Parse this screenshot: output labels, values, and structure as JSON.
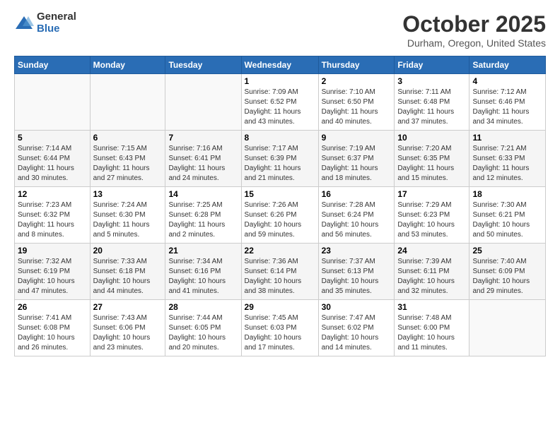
{
  "logo": {
    "general": "General",
    "blue": "Blue"
  },
  "header": {
    "month": "October 2025",
    "location": "Durham, Oregon, United States"
  },
  "weekdays": [
    "Sunday",
    "Monday",
    "Tuesday",
    "Wednesday",
    "Thursday",
    "Friday",
    "Saturday"
  ],
  "weeks": [
    [
      {
        "day": "",
        "info": ""
      },
      {
        "day": "",
        "info": ""
      },
      {
        "day": "",
        "info": ""
      },
      {
        "day": "1",
        "info": "Sunrise: 7:09 AM\nSunset: 6:52 PM\nDaylight: 11 hours\nand 43 minutes."
      },
      {
        "day": "2",
        "info": "Sunrise: 7:10 AM\nSunset: 6:50 PM\nDaylight: 11 hours\nand 40 minutes."
      },
      {
        "day": "3",
        "info": "Sunrise: 7:11 AM\nSunset: 6:48 PM\nDaylight: 11 hours\nand 37 minutes."
      },
      {
        "day": "4",
        "info": "Sunrise: 7:12 AM\nSunset: 6:46 PM\nDaylight: 11 hours\nand 34 minutes."
      }
    ],
    [
      {
        "day": "5",
        "info": "Sunrise: 7:14 AM\nSunset: 6:44 PM\nDaylight: 11 hours\nand 30 minutes."
      },
      {
        "day": "6",
        "info": "Sunrise: 7:15 AM\nSunset: 6:43 PM\nDaylight: 11 hours\nand 27 minutes."
      },
      {
        "day": "7",
        "info": "Sunrise: 7:16 AM\nSunset: 6:41 PM\nDaylight: 11 hours\nand 24 minutes."
      },
      {
        "day": "8",
        "info": "Sunrise: 7:17 AM\nSunset: 6:39 PM\nDaylight: 11 hours\nand 21 minutes."
      },
      {
        "day": "9",
        "info": "Sunrise: 7:19 AM\nSunset: 6:37 PM\nDaylight: 11 hours\nand 18 minutes."
      },
      {
        "day": "10",
        "info": "Sunrise: 7:20 AM\nSunset: 6:35 PM\nDaylight: 11 hours\nand 15 minutes."
      },
      {
        "day": "11",
        "info": "Sunrise: 7:21 AM\nSunset: 6:33 PM\nDaylight: 11 hours\nand 12 minutes."
      }
    ],
    [
      {
        "day": "12",
        "info": "Sunrise: 7:23 AM\nSunset: 6:32 PM\nDaylight: 11 hours\nand 8 minutes."
      },
      {
        "day": "13",
        "info": "Sunrise: 7:24 AM\nSunset: 6:30 PM\nDaylight: 11 hours\nand 5 minutes."
      },
      {
        "day": "14",
        "info": "Sunrise: 7:25 AM\nSunset: 6:28 PM\nDaylight: 11 hours\nand 2 minutes."
      },
      {
        "day": "15",
        "info": "Sunrise: 7:26 AM\nSunset: 6:26 PM\nDaylight: 10 hours\nand 59 minutes."
      },
      {
        "day": "16",
        "info": "Sunrise: 7:28 AM\nSunset: 6:24 PM\nDaylight: 10 hours\nand 56 minutes."
      },
      {
        "day": "17",
        "info": "Sunrise: 7:29 AM\nSunset: 6:23 PM\nDaylight: 10 hours\nand 53 minutes."
      },
      {
        "day": "18",
        "info": "Sunrise: 7:30 AM\nSunset: 6:21 PM\nDaylight: 10 hours\nand 50 minutes."
      }
    ],
    [
      {
        "day": "19",
        "info": "Sunrise: 7:32 AM\nSunset: 6:19 PM\nDaylight: 10 hours\nand 47 minutes."
      },
      {
        "day": "20",
        "info": "Sunrise: 7:33 AM\nSunset: 6:18 PM\nDaylight: 10 hours\nand 44 minutes."
      },
      {
        "day": "21",
        "info": "Sunrise: 7:34 AM\nSunset: 6:16 PM\nDaylight: 10 hours\nand 41 minutes."
      },
      {
        "day": "22",
        "info": "Sunrise: 7:36 AM\nSunset: 6:14 PM\nDaylight: 10 hours\nand 38 minutes."
      },
      {
        "day": "23",
        "info": "Sunrise: 7:37 AM\nSunset: 6:13 PM\nDaylight: 10 hours\nand 35 minutes."
      },
      {
        "day": "24",
        "info": "Sunrise: 7:39 AM\nSunset: 6:11 PM\nDaylight: 10 hours\nand 32 minutes."
      },
      {
        "day": "25",
        "info": "Sunrise: 7:40 AM\nSunset: 6:09 PM\nDaylight: 10 hours\nand 29 minutes."
      }
    ],
    [
      {
        "day": "26",
        "info": "Sunrise: 7:41 AM\nSunset: 6:08 PM\nDaylight: 10 hours\nand 26 minutes."
      },
      {
        "day": "27",
        "info": "Sunrise: 7:43 AM\nSunset: 6:06 PM\nDaylight: 10 hours\nand 23 minutes."
      },
      {
        "day": "28",
        "info": "Sunrise: 7:44 AM\nSunset: 6:05 PM\nDaylight: 10 hours\nand 20 minutes."
      },
      {
        "day": "29",
        "info": "Sunrise: 7:45 AM\nSunset: 6:03 PM\nDaylight: 10 hours\nand 17 minutes."
      },
      {
        "day": "30",
        "info": "Sunrise: 7:47 AM\nSunset: 6:02 PM\nDaylight: 10 hours\nand 14 minutes."
      },
      {
        "day": "31",
        "info": "Sunrise: 7:48 AM\nSunset: 6:00 PM\nDaylight: 10 hours\nand 11 minutes."
      },
      {
        "day": "",
        "info": ""
      }
    ]
  ]
}
